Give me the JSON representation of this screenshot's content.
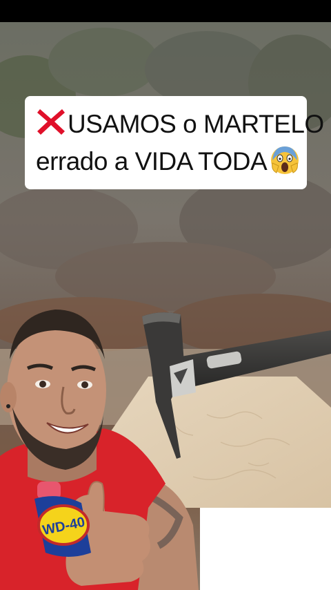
{
  "caption": {
    "line1": "USAMOS o MARTELO",
    "line2": "errado a VIDA TODA",
    "icons": [
      "cross-mark-icon",
      "screaming-face-icon"
    ]
  },
  "can_label": "WD-40",
  "colors": {
    "caption_bg": "#ffffff",
    "cross_mark": "#e0102a",
    "shirt": "#d8232a",
    "can_blue": "#1d3f9a",
    "can_yellow": "#f5d31b"
  }
}
